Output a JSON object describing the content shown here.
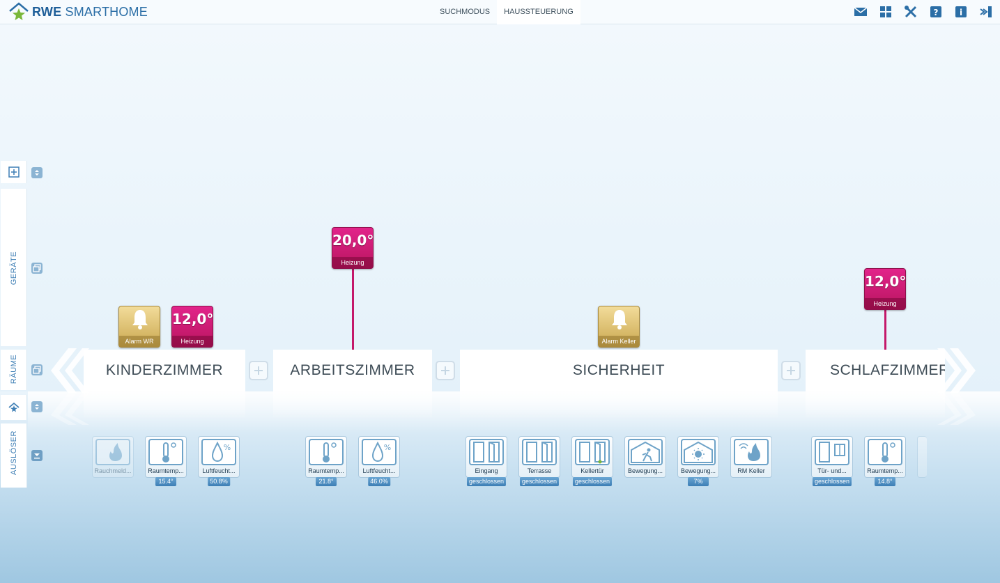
{
  "brand": {
    "name_bold": "RWE",
    "name_rest": "SMARTHOME"
  },
  "tabs": [
    {
      "label": "SUCHMODUS"
    },
    {
      "label": "HAUSSTEUERUNG"
    }
  ],
  "top_icons": [
    "mail-icon",
    "dashboard-icon",
    "tools-icon",
    "help-icon",
    "info-icon",
    "logout-icon"
  ],
  "left_panel": {
    "geraete": "GERÄTE",
    "raeume": "RÄUME",
    "ausloeser": "AUSLÖSER"
  },
  "rooms": [
    {
      "name": "KINDERZIMMER"
    },
    {
      "name": "ARBEITSZIMMER"
    },
    {
      "name": "SICHERHEIT"
    },
    {
      "name": "SCHLAFZIMMER"
    }
  ],
  "devices": {
    "kinder_alarm": {
      "label": "Alarm WR"
    },
    "kinder_heat": {
      "value": "12,0°",
      "label": "Heizung"
    },
    "arbeit_heat": {
      "value": "20,0°",
      "label": "Heizung"
    },
    "sicher_alarm": {
      "label": "Alarm Keller"
    },
    "schlaf_heat": {
      "value": "12,0°",
      "label": "Heizung"
    }
  },
  "sensors": [
    {
      "name": "Rauchmeld...",
      "value": ""
    },
    {
      "name": "Raumtemp...",
      "value": "15.4°"
    },
    {
      "name": "Luftfeucht...",
      "value": "50.8%"
    },
    {
      "name": "Raumtemp...",
      "value": "21.8°"
    },
    {
      "name": "Luftfeucht...",
      "value": "46.0%"
    },
    {
      "name": "Eingang",
      "value": "geschlossen"
    },
    {
      "name": "Terrasse",
      "value": "geschlossen"
    },
    {
      "name": "Kellertür",
      "value": "geschlossen"
    },
    {
      "name": "Bewegung...",
      "value": ""
    },
    {
      "name": "Bewegung...",
      "value": "7%"
    },
    {
      "name": "RM Keller",
      "value": ""
    },
    {
      "name": "Tür- und...",
      "value": "geschlossen"
    },
    {
      "name": "Raumtemp...",
      "value": "14.8°"
    }
  ],
  "colors": {
    "heating": "#d11d77",
    "alarm": "#dcc070",
    "brand": "#2b6ea6"
  }
}
